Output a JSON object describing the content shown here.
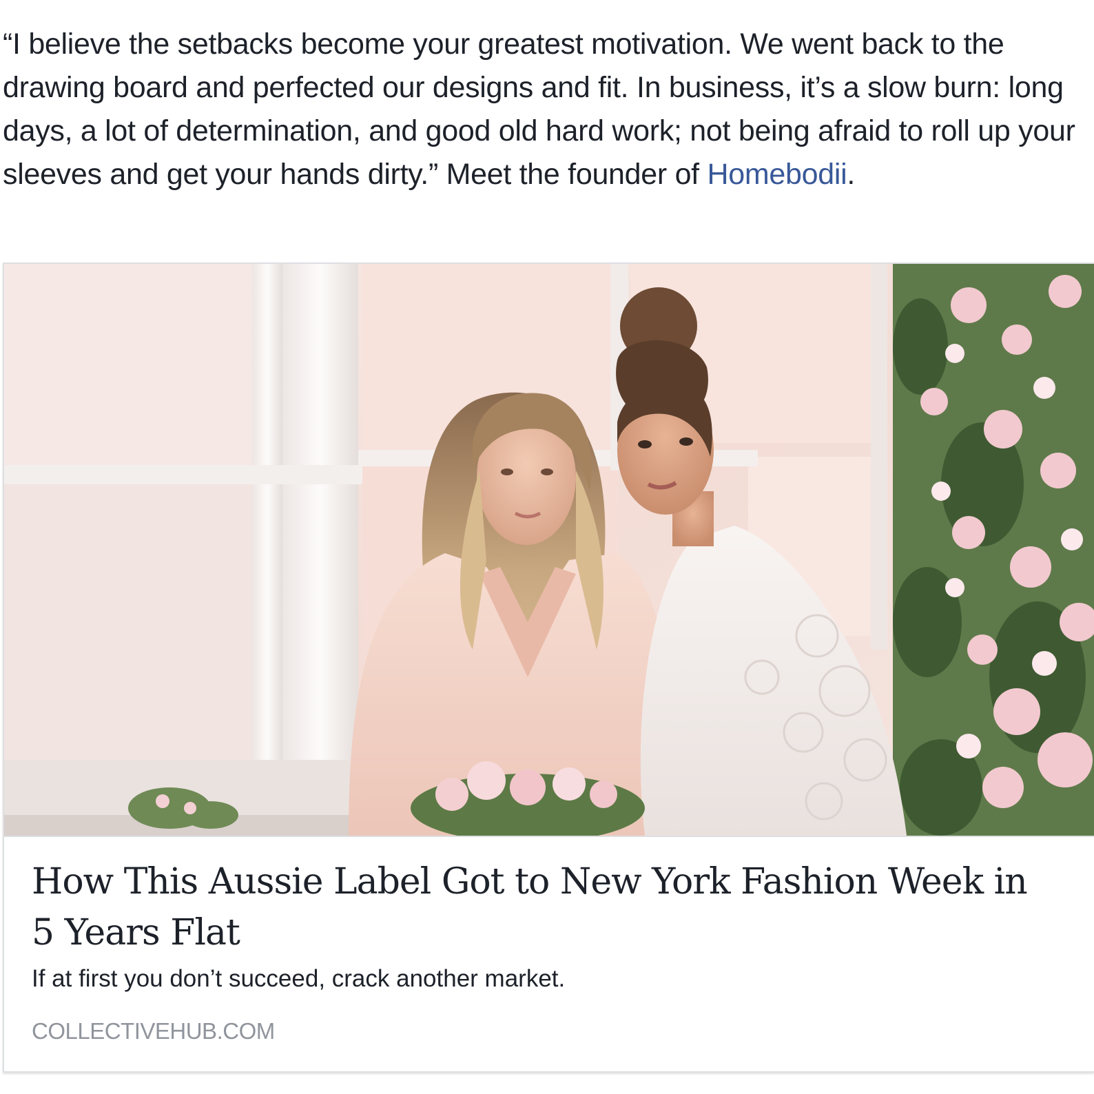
{
  "post": {
    "text_before_link": "“I believe the setbacks become your greatest motivation. We went back to the drawing board and perfected our designs and fit. In business, it’s a slow burn: long days, a lot of determination, and good old hard work; not being afraid to roll up your sleeves and get your hands dirty.” Meet the founder of ",
    "link_text": "Homebodii",
    "text_after_link": ".",
    "link_color": "#385898"
  },
  "link_card": {
    "image_icon": "photo-of-two-women-in-robes",
    "title": "How This Aussie Label Got to New York Fashion Week in 5 Years Flat",
    "description": "If at first you don’t succeed, crack another market.",
    "domain": "COLLECTIVEHUB.COM"
  }
}
